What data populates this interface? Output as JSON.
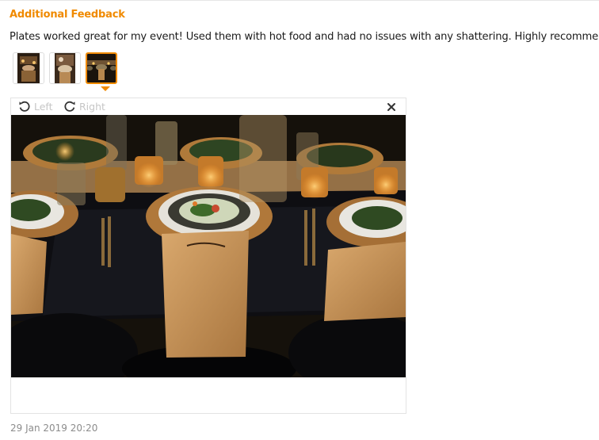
{
  "review": {
    "heading": "Additional Feedback",
    "text": "Plates worked great for my event! Used them with hot food and had no issues with any shattering. Highly recommend!",
    "timestamp": "29 Jan 2019 20:20"
  },
  "thumbnails": [
    {
      "label": "photo 1",
      "selected": false
    },
    {
      "label": "photo 2",
      "selected": false
    },
    {
      "label": "photo 3",
      "selected": true
    }
  ],
  "viewer": {
    "rotate_left_label": "Left",
    "rotate_right_label": "Right",
    "icons": {
      "rotate_left": "rotate-left-icon",
      "rotate_right": "rotate-right-icon",
      "close": "close-icon"
    }
  },
  "colors": {
    "accent": "#f08a00",
    "muted_text": "#8c8c8c",
    "disabled_label": "#c6c6c6"
  }
}
